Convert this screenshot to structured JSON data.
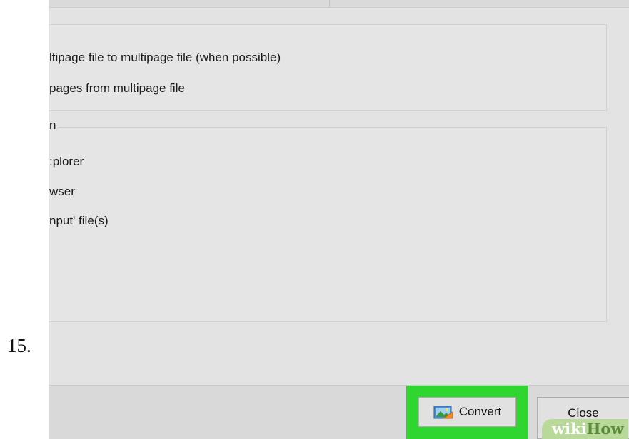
{
  "step": {
    "number": "15."
  },
  "multipage": {
    "options": [
      "ltipage file to multipage file (when possible)",
      "pages from multipage file"
    ]
  },
  "after_convert": {
    "title": "n",
    "options": [
      ":plorer",
      "wser",
      "nput' file(s)"
    ]
  },
  "buttons": {
    "convert_label": "Convert",
    "convert_icon": "image-convert-icon",
    "close_label": "Close"
  },
  "watermark": {
    "part1": "wiki",
    "part2": "How"
  },
  "colors": {
    "highlight": "#2fd62f",
    "dialog_bg": "#e3e3e3"
  }
}
